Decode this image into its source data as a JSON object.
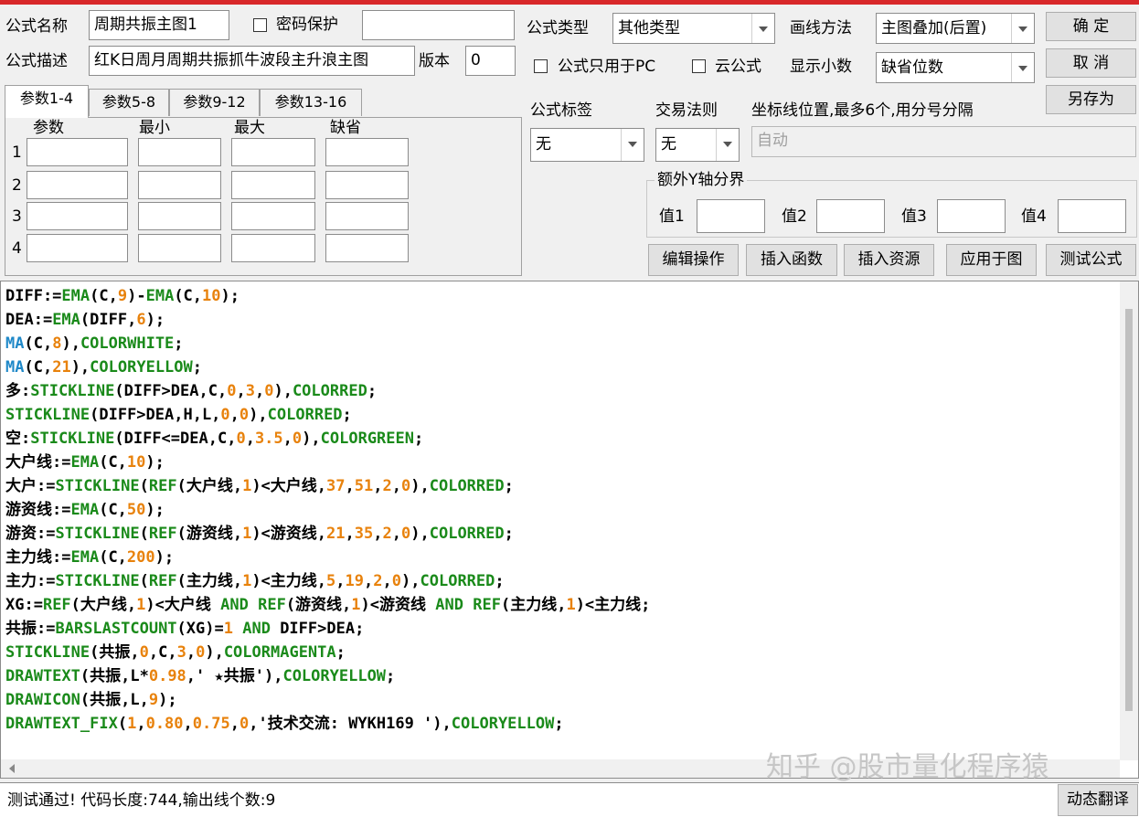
{
  "colors": {
    "keyword_blue": "#1e88c8",
    "function_green": "#1a8a1a",
    "number_orange": "#e8820c",
    "title_bar_red": "#d8282a"
  },
  "form": {
    "name_label": "公式名称",
    "name_value": "周期共振主图1",
    "password_label": "密码保护",
    "desc_label": "公式描述",
    "desc_value": "红K日周月周期共振抓牛波段主升浪主图",
    "version_label": "版本",
    "version_value": "0",
    "type_label": "公式类型",
    "type_value": "其他类型",
    "draw_method_label": "画线方法",
    "draw_method_value": "主图叠加(后置)",
    "pc_only_label": "公式只用于PC",
    "cloud_label": "云公式",
    "decimal_label": "显示小数",
    "decimal_value": "缺省位数",
    "tag_label": "公式标签",
    "tag_value": "无",
    "trade_rule_label": "交易法则",
    "trade_rule_value": "无",
    "axis_label": "坐标线位置,最多6个,用分号分隔",
    "axis_value": "自动",
    "extra_y_label": "额外Y轴分界",
    "extra_y": [
      "值1",
      "值2",
      "值3",
      "值4"
    ]
  },
  "buttons": {
    "ok": "确  定",
    "cancel": "取  消",
    "save_as": "另存为",
    "edit_ops": "编辑操作",
    "insert_func": "插入函数",
    "insert_res": "插入资源",
    "apply": "应用于图",
    "test": "测试公式",
    "dynamic_translate": "动态翻译"
  },
  "tabs": [
    "参数1-4",
    "参数5-8",
    "参数9-12",
    "参数13-16"
  ],
  "params": {
    "headers": [
      "参数",
      "最小",
      "最大",
      "缺省"
    ],
    "rows": [
      "1",
      "2",
      "3",
      "4"
    ]
  },
  "code_lines": [
    [
      [
        "k",
        "DIFF:="
      ],
      [
        "f",
        "EMA"
      ],
      [
        "k",
        "(C,"
      ],
      [
        "n",
        "9"
      ],
      [
        "k",
        ")-"
      ],
      [
        "f",
        "EMA"
      ],
      [
        "k",
        "(C,"
      ],
      [
        "n",
        "10"
      ],
      [
        "k",
        ");"
      ]
    ],
    [
      [
        "k",
        "DEA:="
      ],
      [
        "f",
        "EMA"
      ],
      [
        "k",
        "(DIFF,"
      ],
      [
        "n",
        "6"
      ],
      [
        "k",
        ");"
      ]
    ],
    [
      [
        "b",
        "MA"
      ],
      [
        "k",
        "(C,"
      ],
      [
        "n",
        "8"
      ],
      [
        "k",
        "),"
      ],
      [
        "f",
        "COLORWHITE"
      ],
      [
        "k",
        ";"
      ]
    ],
    [
      [
        "b",
        "MA"
      ],
      [
        "k",
        "(C,"
      ],
      [
        "n",
        "21"
      ],
      [
        "k",
        "),"
      ],
      [
        "f",
        "COLORYELLOW"
      ],
      [
        "k",
        ";"
      ]
    ],
    [
      [
        "k",
        "多:"
      ],
      [
        "f",
        "STICKLINE"
      ],
      [
        "k",
        "(DIFF>DEA,C,"
      ],
      [
        "n",
        "0"
      ],
      [
        "k",
        ","
      ],
      [
        "n",
        "3"
      ],
      [
        "k",
        ","
      ],
      [
        "n",
        "0"
      ],
      [
        "k",
        "),"
      ],
      [
        "f",
        "COLORRED"
      ],
      [
        "k",
        ";"
      ]
    ],
    [
      [
        "f",
        "STICKLINE"
      ],
      [
        "k",
        "(DIFF>DEA,H,L,"
      ],
      [
        "n",
        "0"
      ],
      [
        "k",
        ","
      ],
      [
        "n",
        "0"
      ],
      [
        "k",
        "),"
      ],
      [
        "f",
        "COLORRED"
      ],
      [
        "k",
        ";"
      ]
    ],
    [
      [
        "k",
        "空:"
      ],
      [
        "f",
        "STICKLINE"
      ],
      [
        "k",
        "(DIFF<=DEA,C,"
      ],
      [
        "n",
        "0"
      ],
      [
        "k",
        ","
      ],
      [
        "n",
        "3.5"
      ],
      [
        "k",
        ","
      ],
      [
        "n",
        "0"
      ],
      [
        "k",
        "),"
      ],
      [
        "f",
        "COLORGREEN"
      ],
      [
        "k",
        ";"
      ]
    ],
    [
      [
        "k",
        "大户线:="
      ],
      [
        "f",
        "EMA"
      ],
      [
        "k",
        "(C,"
      ],
      [
        "n",
        "10"
      ],
      [
        "k",
        ");"
      ]
    ],
    [
      [
        "k",
        "大户:="
      ],
      [
        "f",
        "STICKLINE"
      ],
      [
        "k",
        "("
      ],
      [
        "f",
        "REF"
      ],
      [
        "k",
        "(大户线,"
      ],
      [
        "n",
        "1"
      ],
      [
        "k",
        ")<大户线,"
      ],
      [
        "n",
        "37"
      ],
      [
        "k",
        ","
      ],
      [
        "n",
        "51"
      ],
      [
        "k",
        ","
      ],
      [
        "n",
        "2"
      ],
      [
        "k",
        ","
      ],
      [
        "n",
        "0"
      ],
      [
        "k",
        "),"
      ],
      [
        "f",
        "COLORRED"
      ],
      [
        "k",
        ";"
      ]
    ],
    [
      [
        "k",
        "游资线:="
      ],
      [
        "f",
        "EMA"
      ],
      [
        "k",
        "(C,"
      ],
      [
        "n",
        "50"
      ],
      [
        "k",
        ");"
      ]
    ],
    [
      [
        "k",
        "游资:="
      ],
      [
        "f",
        "STICKLINE"
      ],
      [
        "k",
        "("
      ],
      [
        "f",
        "REF"
      ],
      [
        "k",
        "(游资线,"
      ],
      [
        "n",
        "1"
      ],
      [
        "k",
        ")<游资线,"
      ],
      [
        "n",
        "21"
      ],
      [
        "k",
        ","
      ],
      [
        "n",
        "35"
      ],
      [
        "k",
        ","
      ],
      [
        "n",
        "2"
      ],
      [
        "k",
        ","
      ],
      [
        "n",
        "0"
      ],
      [
        "k",
        "),"
      ],
      [
        "f",
        "COLORRED"
      ],
      [
        "k",
        ";"
      ]
    ],
    [
      [
        "k",
        "主力线:="
      ],
      [
        "f",
        "EMA"
      ],
      [
        "k",
        "(C,"
      ],
      [
        "n",
        "200"
      ],
      [
        "k",
        ");"
      ]
    ],
    [
      [
        "k",
        "主力:="
      ],
      [
        "f",
        "STICKLINE"
      ],
      [
        "k",
        "("
      ],
      [
        "f",
        "REF"
      ],
      [
        "k",
        "(主力线,"
      ],
      [
        "n",
        "1"
      ],
      [
        "k",
        ")<主力线,"
      ],
      [
        "n",
        "5"
      ],
      [
        "k",
        ","
      ],
      [
        "n",
        "19"
      ],
      [
        "k",
        ","
      ],
      [
        "n",
        "2"
      ],
      [
        "k",
        ","
      ],
      [
        "n",
        "0"
      ],
      [
        "k",
        "),"
      ],
      [
        "f",
        "COLORRED"
      ],
      [
        "k",
        ";"
      ]
    ],
    [
      [
        "k",
        "XG:="
      ],
      [
        "f",
        "REF"
      ],
      [
        "k",
        "(大户线,"
      ],
      [
        "n",
        "1"
      ],
      [
        "k",
        ")<大户线 "
      ],
      [
        "f",
        "AND"
      ],
      [
        "k",
        " "
      ],
      [
        "f",
        "REF"
      ],
      [
        "k",
        "(游资线,"
      ],
      [
        "n",
        "1"
      ],
      [
        "k",
        ")<游资线 "
      ],
      [
        "f",
        "AND"
      ],
      [
        "k",
        " "
      ],
      [
        "f",
        "REF"
      ],
      [
        "k",
        "(主力线,"
      ],
      [
        "n",
        "1"
      ],
      [
        "k",
        ")<主力线;"
      ]
    ],
    [
      [
        "k",
        "共振:="
      ],
      [
        "f",
        "BARSLASTCOUNT"
      ],
      [
        "k",
        "(XG)="
      ],
      [
        "n",
        "1"
      ],
      [
        "k",
        " "
      ],
      [
        "f",
        "AND"
      ],
      [
        "k",
        " DIFF>DEA;"
      ]
    ],
    [
      [
        "f",
        "STICKLINE"
      ],
      [
        "k",
        "(共振,"
      ],
      [
        "n",
        "0"
      ],
      [
        "k",
        ",C,"
      ],
      [
        "n",
        "3"
      ],
      [
        "k",
        ","
      ],
      [
        "n",
        "0"
      ],
      [
        "k",
        "),"
      ],
      [
        "f",
        "COLORMAGENTA"
      ],
      [
        "k",
        ";"
      ]
    ],
    [
      [
        "f",
        "DRAWTEXT"
      ],
      [
        "k",
        "(共振,L*"
      ],
      [
        "n",
        "0.98"
      ],
      [
        "k",
        ",' ★共振'),"
      ],
      [
        "f",
        "COLORYELLOW"
      ],
      [
        "k",
        ";"
      ]
    ],
    [
      [
        "f",
        "DRAWICON"
      ],
      [
        "k",
        "(共振,L,"
      ],
      [
        "n",
        "9"
      ],
      [
        "k",
        ");"
      ]
    ],
    [
      [
        "f",
        "DRAWTEXT_FIX"
      ],
      [
        "k",
        "("
      ],
      [
        "n",
        "1"
      ],
      [
        "k",
        ","
      ],
      [
        "n",
        "0.80"
      ],
      [
        "k",
        ","
      ],
      [
        "n",
        "0.75"
      ],
      [
        "k",
        ","
      ],
      [
        "n",
        "0"
      ],
      [
        "k",
        ",'技术交流: WYKH169 '),"
      ],
      [
        "f",
        "COLORYELLOW"
      ],
      [
        "k",
        ";"
      ]
    ]
  ],
  "watermark": "知乎 @股市量化程序猿",
  "status": "测试通过! 代码长度:744,输出线个数:9"
}
